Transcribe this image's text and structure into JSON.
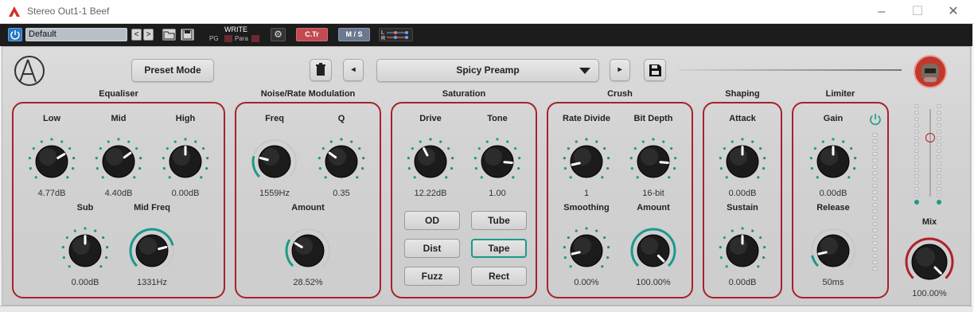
{
  "window": {
    "title": "Stereo Out1-1 Beef"
  },
  "hostbar": {
    "preset_name": "Default",
    "prev": "<",
    "next": ">",
    "write": "WRITE",
    "pg": "PG",
    "para": "Para",
    "ctr": "C.Tr",
    "ms": "M / S",
    "l": "L",
    "r": "R"
  },
  "toolbar": {
    "preset_mode": "Preset Mode",
    "preset_name": "Spicy Preamp",
    "prev": "◂",
    "next": "▸"
  },
  "colors": {
    "panel_border": "#a7222c",
    "accent": "#1a9a8a",
    "knob": "#1a1a1a"
  },
  "sections": {
    "equaliser": {
      "title": "Equaliser",
      "low": {
        "label": "Low",
        "value": "4.77dB"
      },
      "mid": {
        "label": "Mid",
        "value": "4.40dB"
      },
      "high": {
        "label": "High",
        "value": "0.00dB"
      },
      "sub": {
        "label": "Sub",
        "value": "0.00dB"
      },
      "midfreq": {
        "label": "Mid Freq",
        "value": "1331Hz"
      }
    },
    "noise": {
      "title": "Noise/Rate Modulation",
      "freq": {
        "label": "Freq",
        "value": "1559Hz"
      },
      "q": {
        "label": "Q",
        "value": "0.35"
      },
      "amount": {
        "label": "Amount",
        "value": "28.52%"
      }
    },
    "saturation": {
      "title": "Saturation",
      "drive": {
        "label": "Drive",
        "value": "12.22dB"
      },
      "tone": {
        "label": "Tone",
        "value": "1.00"
      },
      "modes": [
        "OD",
        "Tube",
        "Dist",
        "Tape",
        "Fuzz",
        "Rect"
      ],
      "selected_mode": "Tape"
    },
    "crush": {
      "title": "Crush",
      "rate_divide": {
        "label": "Rate Divide",
        "value": "1"
      },
      "bit_depth": {
        "label": "Bit Depth",
        "value": "16-bit"
      },
      "smoothing": {
        "label": "Smoothing",
        "value": "0.00%"
      },
      "amount": {
        "label": "Amount",
        "value": "100.00%"
      }
    },
    "shaping": {
      "title": "Shaping",
      "attack": {
        "label": "Attack",
        "value": "0.00dB"
      },
      "sustain": {
        "label": "Sustain",
        "value": "0.00dB"
      }
    },
    "limiter": {
      "title": "Limiter",
      "gain": {
        "label": "Gain",
        "value": "0.00dB"
      },
      "release": {
        "label": "Release",
        "value": "50ms"
      }
    },
    "mix": {
      "label": "Mix",
      "value": "100.00%"
    }
  },
  "knob_levels": {
    "eq_low": 0.72,
    "eq_mid": 0.7,
    "eq_high": 0.5,
    "eq_sub": 0.5,
    "eq_midfreq": 0.78,
    "nz_freq": 0.22,
    "nz_q": 0.3,
    "nz_amount": 0.28,
    "sat_drive": 0.4,
    "sat_tone": 0.85,
    "cr_rate": 0.12,
    "cr_bit": 0.85,
    "cr_smooth": 0.12,
    "cr_amount": 1.0,
    "sh_attack": 0.5,
    "sh_sustain": 0.5,
    "lim_gain": 0.5,
    "lim_release": 0.12,
    "mix": 1.0
  }
}
